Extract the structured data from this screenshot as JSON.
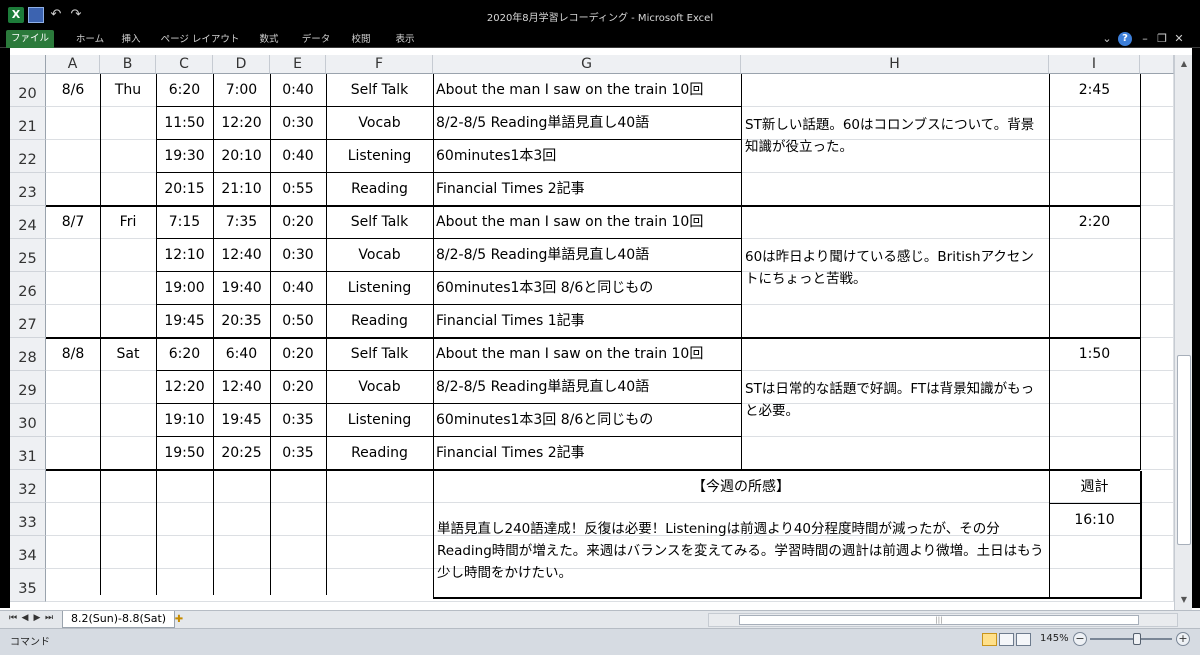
{
  "window": {
    "title": "2020年8月学習レコーディング - Microsoft Excel",
    "qat_icons": [
      "excel-icon",
      "save-icon",
      "undo-icon",
      "redo-icon"
    ]
  },
  "ribbon": {
    "tabs": [
      "ファイル",
      "ホーム",
      "挿入",
      "ページ レイアウト",
      "数式",
      "データ",
      "校閲",
      "表示"
    ]
  },
  "columns": [
    "A",
    "B",
    "C",
    "D",
    "E",
    "F",
    "G",
    "H",
    "I"
  ],
  "rows": [
    "20",
    "21",
    "22",
    "23",
    "24",
    "25",
    "26",
    "27",
    "28",
    "29",
    "30",
    "31",
    "32",
    "33",
    "34",
    "35"
  ],
  "days": [
    {
      "date": "8/6",
      "weekday": "Thu",
      "total": "2:45",
      "note": "ST新しい話題。60はコロンブスについて。背景知識が役立った。",
      "entries": [
        {
          "start": "6:20",
          "end": "7:00",
          "duration": "0:40",
          "category": "Self Talk",
          "detail": "About the man I saw on the train 10回"
        },
        {
          "start": "11:50",
          "end": "12:20",
          "duration": "0:30",
          "category": "Vocab",
          "detail": "8/2-8/5 Reading単語見直し40語"
        },
        {
          "start": "19:30",
          "end": "20:10",
          "duration": "0:40",
          "category": "Listening",
          "detail": "60minutes1本3回"
        },
        {
          "start": "20:15",
          "end": "21:10",
          "duration": "0:55",
          "category": "Reading",
          "detail": "Financial Times 2記事"
        }
      ]
    },
    {
      "date": "8/7",
      "weekday": "Fri",
      "total": "2:20",
      "note": "60は昨日より聞けている感じ。Britishアクセントにちょっと苦戦。",
      "entries": [
        {
          "start": "7:15",
          "end": "7:35",
          "duration": "0:20",
          "category": "Self Talk",
          "detail": "About the man I saw on the train 10回"
        },
        {
          "start": "12:10",
          "end": "12:40",
          "duration": "0:30",
          "category": "Vocab",
          "detail": "8/2-8/5 Reading単語見直し40語"
        },
        {
          "start": "19:00",
          "end": "19:40",
          "duration": "0:40",
          "category": "Listening",
          "detail": "60minutes1本3回 8/6と同じもの"
        },
        {
          "start": "19:45",
          "end": "20:35",
          "duration": "0:50",
          "category": "Reading",
          "detail": "Financial Times 1記事"
        }
      ]
    },
    {
      "date": "8/8",
      "weekday": "Sat",
      "total": "1:50",
      "note": "STは日常的な話題で好調。FTは背景知識がもっと必要。",
      "entries": [
        {
          "start": "6:20",
          "end": "6:40",
          "duration": "0:20",
          "category": "Self Talk",
          "detail": "About the man I saw on the train 10回"
        },
        {
          "start": "12:20",
          "end": "12:40",
          "duration": "0:20",
          "category": "Vocab",
          "detail": "8/2-8/5 Reading単語見直し40語"
        },
        {
          "start": "19:10",
          "end": "19:45",
          "duration": "0:35",
          "category": "Listening",
          "detail": "60minutes1本3回 8/6と同じもの"
        },
        {
          "start": "19:50",
          "end": "20:25",
          "duration": "0:35",
          "category": "Reading",
          "detail": "Financial Times 2記事"
        }
      ]
    }
  ],
  "summary": {
    "header": "【今週の所感】",
    "text": "単語見直し240語達成！反復は必要！Listeningは前週より40分程度時間が減ったが、その分Reading時間が増えた。来週はバランスを変えてみる。学習時間の週計は前週より微増。土日はもう少し時間をかけたい。",
    "weekly_label": "週計",
    "weekly_total": "16:10"
  },
  "sheets": {
    "active": "8.2(Sun)-8.8(Sat)"
  },
  "status": {
    "mode": "コマンド",
    "zoom": "145%"
  }
}
